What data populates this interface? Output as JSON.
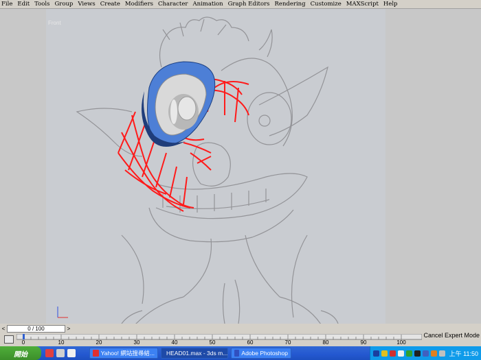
{
  "menu": [
    "File",
    "Edit",
    "Tools",
    "Group",
    "Views",
    "Create",
    "Modifiers",
    "Character",
    "Animation",
    "Graph Editors",
    "Rendering",
    "Customize",
    "MAXScript",
    "Help"
  ],
  "viewport": {
    "label": "Front"
  },
  "time_slider": {
    "value": "0 / 100",
    "prev": "<",
    "next": ">"
  },
  "status": {
    "mode": "Cancel Expert Mode"
  },
  "timeline": {
    "ticks": [
      "0",
      "10",
      "20",
      "30",
      "40",
      "50",
      "60",
      "70",
      "80",
      "90",
      "100"
    ]
  },
  "taskbar": {
    "start": "開始",
    "tasks": [
      {
        "label": "Yahoo! 網站搜尋結...",
        "color": "#e03030"
      },
      {
        "label": "HEAD01.max - 3ds m...",
        "color": "#208040"
      },
      {
        "label": "Adobe Photoshop",
        "color": "#3050c0"
      }
    ],
    "clock": "上午 11:50"
  },
  "colors": {
    "wire": "#ff1a1a",
    "eye_ring": "#4d7fd6",
    "eyeball": "#d8d8d8",
    "accent": "#2458d0"
  }
}
